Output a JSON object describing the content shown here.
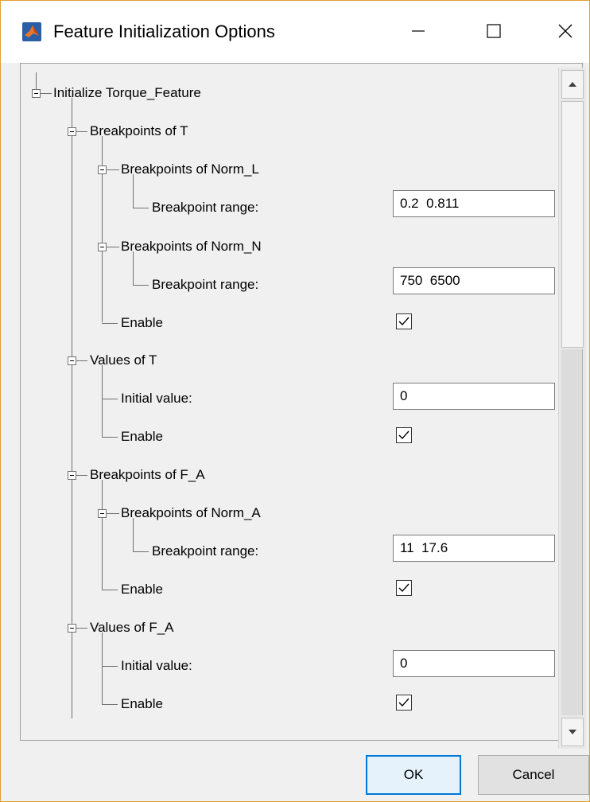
{
  "window": {
    "title": "Feature Initialization Options",
    "icon": "matlab-icon",
    "controls": {
      "minimize": "minimize-icon",
      "maximize": "maximize-icon",
      "close": "close-icon"
    }
  },
  "tree": {
    "root_label": "Initialize Torque_Feature",
    "breakpoints_T": {
      "label": "Breakpoints of T",
      "norm_l": {
        "label": "Breakpoints of Norm_L",
        "range_label": "Breakpoint range:",
        "range_value": "0.2  0.811"
      },
      "norm_n": {
        "label": "Breakpoints of Norm_N",
        "range_label": "Breakpoint range:",
        "range_value": "750  6500"
      },
      "enable_label": "Enable",
      "enabled": true
    },
    "values_T": {
      "label": "Values of T",
      "initial_label": "Initial value:",
      "initial_value": "0",
      "enable_label": "Enable",
      "enabled": true
    },
    "breakpoints_FA": {
      "label": "Breakpoints of F_A",
      "norm_a": {
        "label": "Breakpoints of Norm_A",
        "range_label": "Breakpoint range:",
        "range_value": "11  17.6"
      },
      "enable_label": "Enable",
      "enabled": true
    },
    "values_FA": {
      "label": "Values of F_A",
      "initial_label": "Initial value:",
      "initial_value": "0",
      "enable_label": "Enable",
      "enabled": true
    }
  },
  "buttons": {
    "ok": "OK",
    "cancel": "Cancel"
  }
}
